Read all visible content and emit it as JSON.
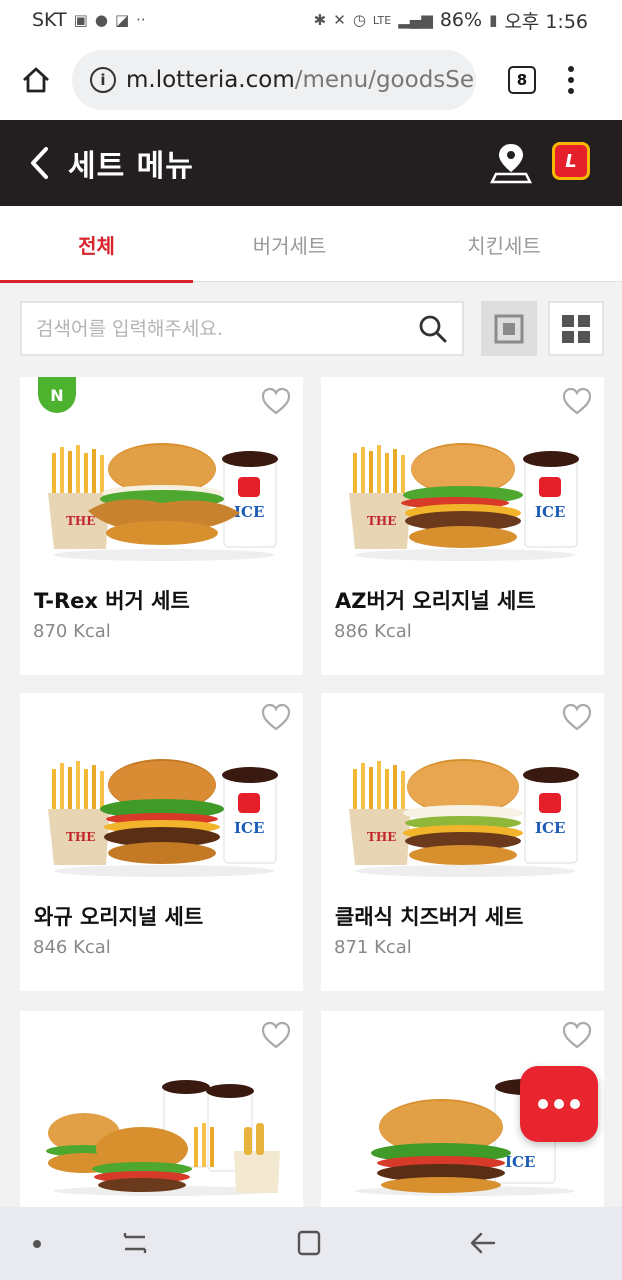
{
  "status_bar": {
    "carrier": "SKT",
    "battery": "86%",
    "time": "오후 1:56",
    "network": "LTE"
  },
  "browser": {
    "url_host": "m.lotteria.com",
    "url_path": "/menu/goodsSe",
    "tab_count": "8"
  },
  "header": {
    "title": "세트 메뉴",
    "logo_text": "L"
  },
  "category_tabs": [
    {
      "label": "전체",
      "active": true
    },
    {
      "label": "버거세트",
      "active": false
    },
    {
      "label": "치킨세트",
      "active": false
    }
  ],
  "search": {
    "placeholder": "검색어를 입력해주세요."
  },
  "products": [
    {
      "name": "T-Rex 버거 세트",
      "kcal": "870 Kcal",
      "badge": "N"
    },
    {
      "name": "AZ버거 오리지널 세트",
      "kcal": "886 Kcal"
    },
    {
      "name": "와규 오리지널 세트",
      "kcal": "846 Kcal"
    },
    {
      "name": "클래식 치즈버거 세트",
      "kcal": "871 Kcal"
    },
    {
      "name": "",
      "kcal": ""
    },
    {
      "name": "",
      "kcal": ""
    }
  ],
  "colors": {
    "brand_red": "#d8232a",
    "header_bg": "#231f20",
    "new_badge": "#4db32e"
  },
  "icons": {
    "home": "home-icon",
    "info": "info-icon",
    "more": "more-vert-icon",
    "back": "chevron-left-icon",
    "map": "map-pin-icon",
    "search": "search-icon",
    "favorite": "heart-outline-icon",
    "chat": "chat-dots-icon"
  }
}
